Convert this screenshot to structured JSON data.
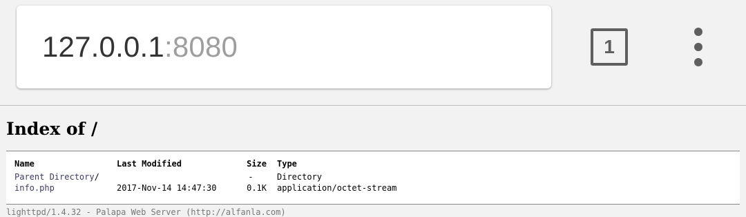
{
  "browser": {
    "url_host": "127.0.0.1",
    "url_port": ":8080",
    "tab_count": "1"
  },
  "page": {
    "title": "Index of /",
    "columns": {
      "name": "Name",
      "modified": "Last Modified",
      "size": "Size",
      "type": "Type"
    },
    "rows": [
      {
        "name": "Parent Directory",
        "suffix": "/",
        "modified": "",
        "size": "-",
        "type": "Directory"
      },
      {
        "name": "info.php",
        "suffix": "",
        "modified": "2017-Nov-14 14:47:30",
        "size": "0.1K",
        "type": "application/octet-stream"
      }
    ],
    "footer": "lighttpd/1.4.32 - Palapa Web Server (http://alfanla.com)"
  }
}
